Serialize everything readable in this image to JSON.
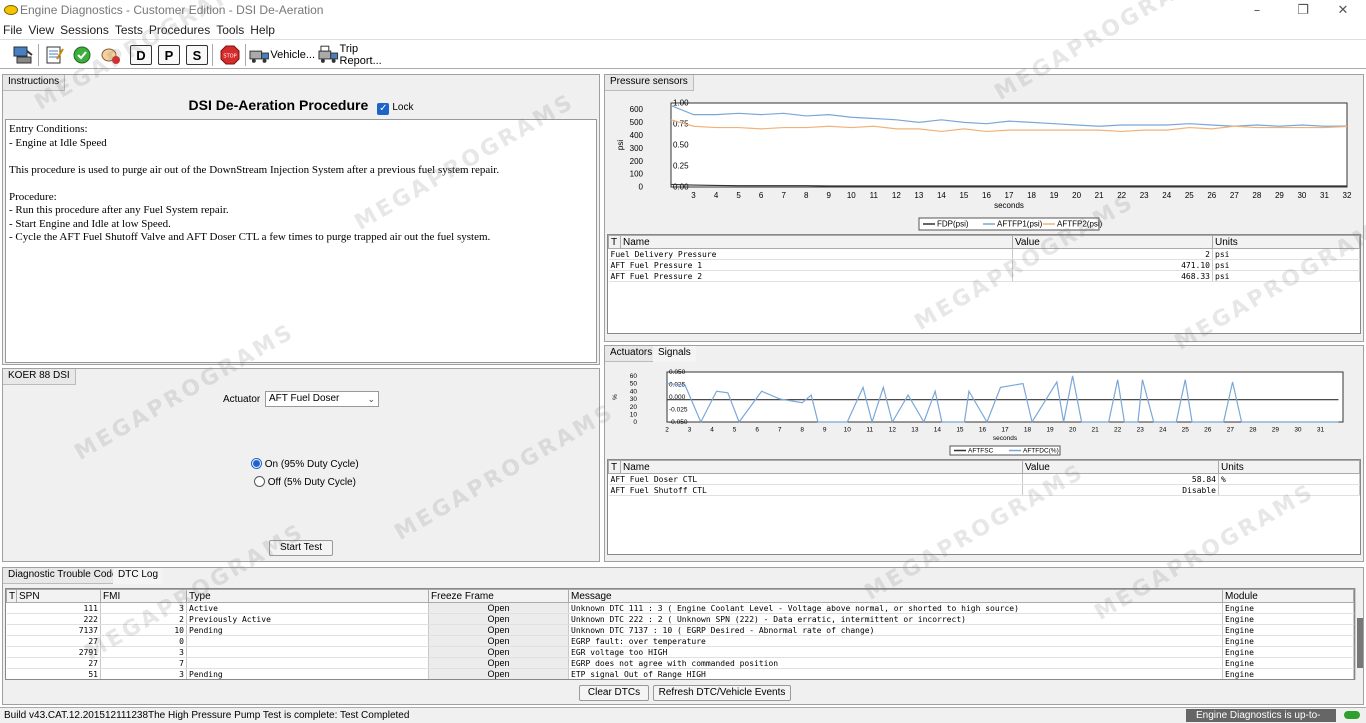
{
  "window": {
    "title": "Engine Diagnostics - Customer Edition - DSI De-Aeration"
  },
  "menu": [
    "File",
    "View",
    "Sessions",
    "Tests",
    "Procedures",
    "Tools",
    "Help"
  ],
  "toolbar": {
    "d_label": "D",
    "p_label": "P",
    "s_label": "S",
    "vehicle_label": "Vehicle...",
    "trip_report_label": "Trip Report..."
  },
  "instructions": {
    "tab": "Instructions",
    "heading": "DSI De-Aeration Procedure",
    "lock_label": "Lock",
    "lock_checked": true,
    "lines": [
      "Entry Conditions:",
      "- Engine at Idle Speed",
      "",
      "This procedure is used to purge air out of the DownStream Injection System after a previous fuel system repair.",
      "",
      "Procedure:",
      "- Run this procedure after any Fuel System repair.",
      "- Start Engine and Idle at low Speed.",
      "- Cycle the AFT Fuel Shutoff Valve and AFT Doser CTL a few times to purge trapped air out the fuel system."
    ]
  },
  "koer": {
    "tab": "KOER 88 DSI",
    "actuator_label": "Actuator",
    "actuator_value": "AFT Fuel Doser",
    "radio_on": "On (95% Duty Cycle)",
    "radio_off": "Off (5% Duty Cycle)",
    "start_button": "Start Test"
  },
  "pressure": {
    "tab": "Pressure sensors",
    "table_headers": [
      "T",
      "Name",
      "Value",
      "Units"
    ],
    "rows": [
      {
        "name": "Fuel Delivery Pressure",
        "value": "2",
        "units": "psi"
      },
      {
        "name": "AFT Fuel Pressure 1",
        "value": "471.10",
        "units": "psi"
      },
      {
        "name": "AFT Fuel Pressure 2",
        "value": "468.33",
        "units": "psi"
      }
    ]
  },
  "actuators": {
    "tabs": [
      "Actuators",
      "Signals"
    ],
    "table_headers": [
      "T",
      "Name",
      "Value",
      "Units"
    ],
    "rows": [
      {
        "name": "AFT Fuel Doser CTL",
        "value": "58.84",
        "units": "%"
      },
      {
        "name": "AFT Fuel Shutoff CTL",
        "value": "Disable",
        "units": ""
      }
    ]
  },
  "chart_data": [
    {
      "type": "line",
      "xlabel": "seconds",
      "ylabel": "psi",
      "x_ticks": [
        3,
        4,
        5,
        6,
        7,
        8,
        9,
        10,
        11,
        12,
        13,
        14,
        15,
        16,
        17,
        18,
        19,
        20,
        21,
        22,
        23,
        24,
        25,
        26,
        27,
        28,
        29,
        30,
        31,
        32
      ],
      "y_ticks_left": [
        0,
        100,
        200,
        300,
        400,
        500,
        600
      ],
      "y_ticks_right": [
        "0.00",
        "0.25",
        "0.50",
        "0.75",
        "1.00"
      ],
      "ylim": [
        0,
        650
      ],
      "legend": "bottom",
      "x": [
        2,
        3,
        4,
        5,
        6,
        7,
        8,
        9,
        10,
        11,
        12,
        13,
        14,
        15,
        16,
        17,
        18,
        19,
        20,
        21,
        22,
        23,
        24,
        25,
        26,
        27,
        28,
        29,
        30,
        31,
        32
      ],
      "series": [
        {
          "name": "FDP(psi)",
          "color": "#333333",
          "values": [
            20,
            15,
            12,
            10,
            10,
            10,
            10,
            8,
            8,
            8,
            8,
            8,
            8,
            8,
            8,
            8,
            8,
            8,
            8,
            8,
            8,
            8,
            8,
            8,
            8,
            8,
            8,
            8,
            8,
            8,
            8
          ]
        },
        {
          "name": "AFTFP1(psi)",
          "color": "#7ba7d8",
          "values": [
            630,
            560,
            560,
            570,
            560,
            570,
            550,
            560,
            540,
            530,
            520,
            500,
            520,
            500,
            490,
            510,
            500,
            490,
            480,
            470,
            480,
            480,
            480,
            490,
            480,
            470,
            480,
            470,
            480,
            470,
            471
          ]
        },
        {
          "name": "AFTFP2(psi)",
          "color": "#f0b27a",
          "values": [
            520,
            470,
            460,
            460,
            450,
            460,
            460,
            470,
            460,
            470,
            450,
            450,
            430,
            450,
            430,
            440,
            440,
            440,
            440,
            440,
            430,
            440,
            440,
            460,
            450,
            470,
            460,
            460,
            460,
            460,
            468
          ]
        }
      ]
    },
    {
      "type": "line",
      "xlabel": "seconds",
      "ylabel": "%",
      "x_ticks": [
        2,
        3,
        4,
        5,
        6,
        7,
        8,
        9,
        10,
        11,
        12,
        13,
        14,
        15,
        16,
        17,
        18,
        19,
        20,
        21,
        22,
        23,
        24,
        25,
        26,
        27,
        28,
        29,
        30,
        31
      ],
      "y_ticks_left": [
        0,
        10,
        20,
        30,
        40,
        50,
        60
      ],
      "y_ticks_right": [
        "-0.050",
        "-0.025",
        "0.000",
        "0.025",
        "0.050"
      ],
      "ylim": [
        0,
        65
      ],
      "legend": "bottom",
      "series": [
        {
          "name": "AFTFSC",
          "color": "#333333",
          "points": [
            [
              2,
              29
            ],
            [
              31.8,
              29
            ]
          ]
        },
        {
          "name": "AFTFDC(%)",
          "color": "#7ba7d8",
          "points": [
            [
              2,
              50
            ],
            [
              2.8,
              48
            ],
            [
              3.5,
              0
            ],
            [
              4.2,
              40
            ],
            [
              4.7,
              38
            ],
            [
              5.2,
              0
            ],
            [
              6.2,
              40
            ],
            [
              7,
              30
            ],
            [
              8,
              25
            ],
            [
              8.4,
              35
            ],
            [
              8.7,
              0
            ],
            [
              10,
              0
            ],
            [
              10.7,
              45
            ],
            [
              11.1,
              0
            ],
            [
              11.6,
              45
            ],
            [
              12,
              0
            ],
            [
              12.7,
              35
            ],
            [
              13.4,
              0
            ],
            [
              13.9,
              40
            ],
            [
              14.2,
              0
            ],
            [
              15.2,
              0
            ],
            [
              15.4,
              40
            ],
            [
              16.2,
              0
            ],
            [
              16.8,
              45
            ],
            [
              17.8,
              50
            ],
            [
              18.2,
              0
            ],
            [
              19.3,
              52
            ],
            [
              19.6,
              0
            ],
            [
              20,
              60
            ],
            [
              20.4,
              0
            ],
            [
              21.6,
              0
            ],
            [
              22,
              55
            ],
            [
              22.3,
              0
            ],
            [
              22.9,
              0
            ],
            [
              23.1,
              55
            ],
            [
              23.6,
              0
            ],
            [
              24.6,
              0
            ],
            [
              25,
              55
            ],
            [
              25.3,
              0
            ],
            [
              26.7,
              0
            ],
            [
              27.1,
              52
            ],
            [
              27.5,
              0
            ],
            [
              31.8,
              0
            ]
          ]
        }
      ]
    }
  ],
  "dtc": {
    "tabs": [
      "Diagnostic Trouble Codes",
      "DTC Log"
    ],
    "headers": [
      "T",
      "SPN",
      "FMI",
      "Type",
      "Freeze Frame",
      "Message",
      "Module"
    ],
    "rows": [
      {
        "spn": "111",
        "fmi": "3",
        "type": "Active",
        "freeze": "Open",
        "message": "Unknown DTC 111 : 3  ( Engine Coolant Level - Voltage above normal, or shorted to high source)",
        "module": "Engine"
      },
      {
        "spn": "222",
        "fmi": "2",
        "type": "Previously Active",
        "freeze": "Open",
        "message": "Unknown DTC 222 : 2  ( Unknown SPN (222) - Data erratic, intermittent or incorrect)",
        "module": "Engine"
      },
      {
        "spn": "7137",
        "fmi": "10",
        "type": "Pending",
        "freeze": "Open",
        "message": "Unknown DTC 7137 : 10  ( EGRP Desired - Abnormal rate of change)",
        "module": "Engine"
      },
      {
        "spn": "27",
        "fmi": "0",
        "type": "",
        "freeze": "Open",
        "message": "EGRP fault: over temperature",
        "module": "Engine"
      },
      {
        "spn": "2791",
        "fmi": "3",
        "type": "",
        "freeze": "Open",
        "message": "EGR voltage too HIGH",
        "module": "Engine"
      },
      {
        "spn": "27",
        "fmi": "7",
        "type": "",
        "freeze": "Open",
        "message": "EGRP does not agree with commanded position",
        "module": "Engine"
      },
      {
        "spn": "51",
        "fmi": "3",
        "type": "Pending",
        "freeze": "Open",
        "message": "ETP signal Out of Range HIGH",
        "module": "Engine"
      }
    ],
    "clear_button": "Clear DTCs",
    "refresh_button": "Refresh DTC/Vehicle Events"
  },
  "status": {
    "build": "Build v43.CAT.12.201512111238",
    "message": "The High Pressure Pump Test is complete: Test Completed",
    "update": "Engine Diagnostics is up-to-date"
  },
  "colors": {
    "accent": "#1e63c7",
    "status_ok": "#2ea02e",
    "stop": "#d62b2b"
  }
}
